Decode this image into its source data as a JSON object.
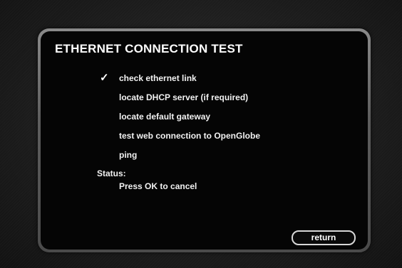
{
  "dialog": {
    "title": "ETHERNET CONNECTION TEST",
    "steps": [
      {
        "label": "check ethernet link",
        "checked": true,
        "check_glyph": "✓"
      },
      {
        "label": "locate DHCP server (if required)",
        "checked": false
      },
      {
        "label": "locate default gateway",
        "checked": false
      },
      {
        "label": "test web connection to OpenGlobe",
        "checked": false
      },
      {
        "label": "ping",
        "checked": false
      }
    ],
    "status_label": "Status:",
    "status_text": "Press OK to cancel",
    "return_label": "return"
  },
  "colors": {
    "background": "#1a1a1a",
    "panel_border": "#6e6e6e",
    "panel_fill": "#050505",
    "text": "#f2f2f2"
  }
}
